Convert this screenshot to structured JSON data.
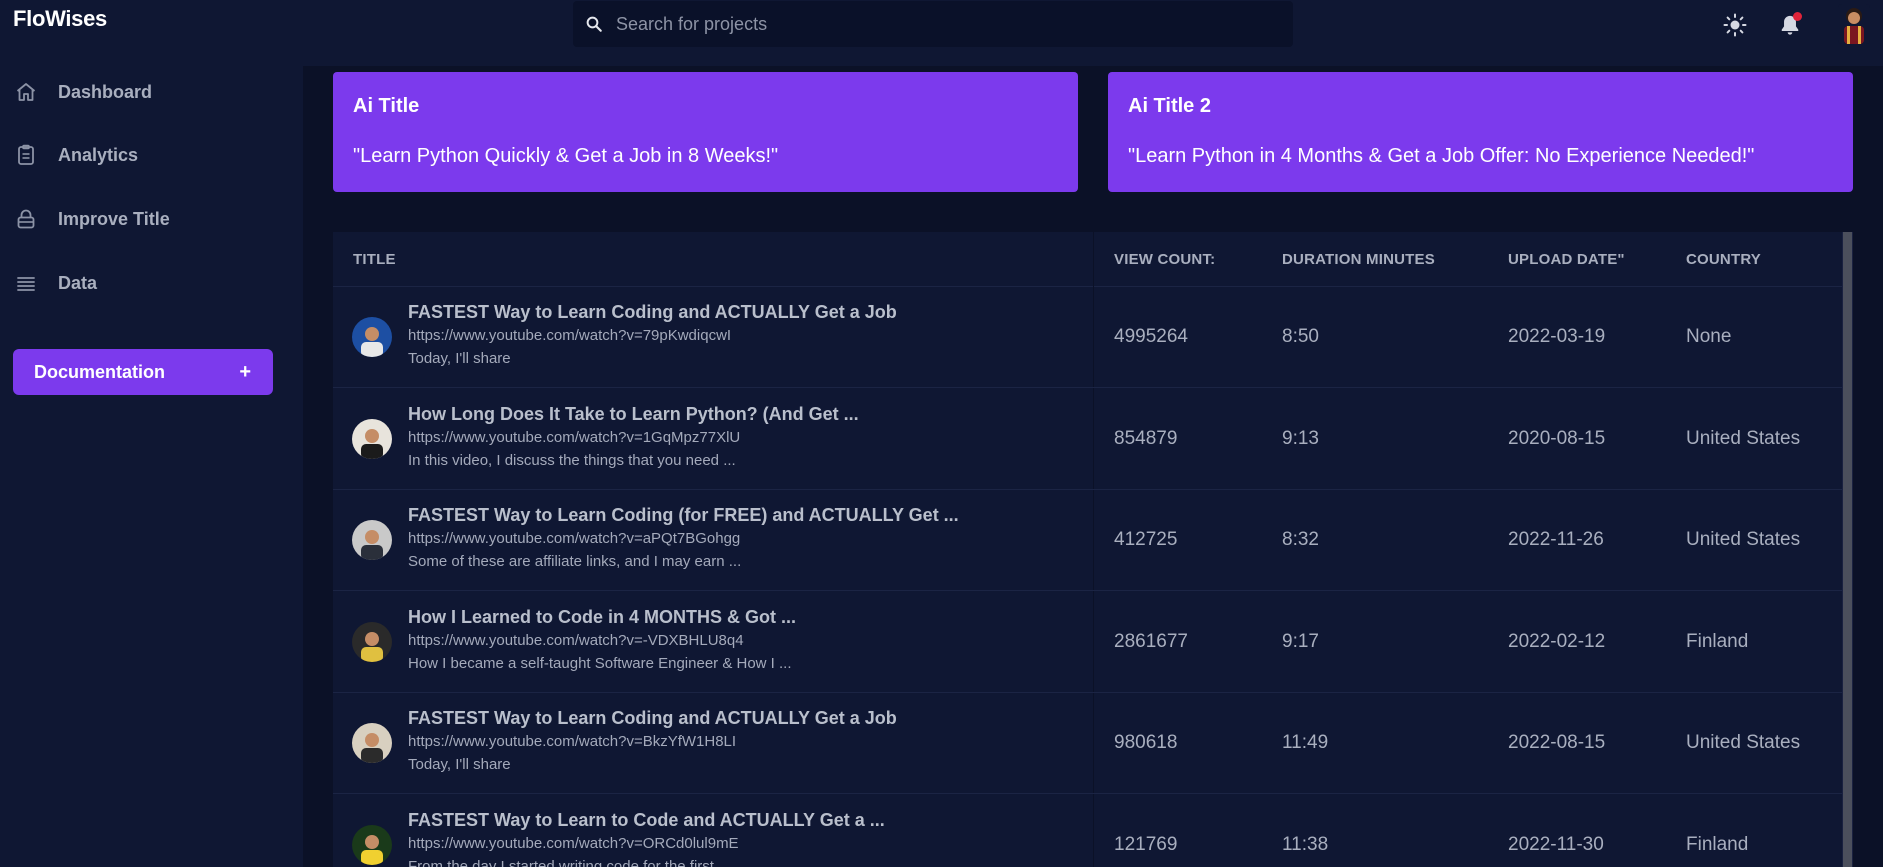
{
  "app": {
    "name": "FloWises"
  },
  "search": {
    "placeholder": "Search for projects"
  },
  "sidebar": {
    "items": [
      {
        "label": "Dashboard",
        "icon": "home-icon"
      },
      {
        "label": "Analytics",
        "icon": "clipboard-icon"
      },
      {
        "label": "Improve Title",
        "icon": "lock-icon"
      },
      {
        "label": "Data",
        "icon": "list-icon"
      }
    ],
    "documentation": {
      "label": "Documentation",
      "plus": "+"
    }
  },
  "ai_cards": [
    {
      "title": "Ai Title",
      "text": "\"Learn Python Quickly & Get a Job in 8 Weeks!\""
    },
    {
      "title": "Ai Title 2",
      "text": "\"Learn Python in 4 Months & Get a Job Offer: No Experience Needed!\""
    }
  ],
  "table": {
    "headers": [
      "TITLE",
      "VIEW COUNT:",
      "DURATION MINUTES",
      "UPLOAD DATE\"",
      "COUNTRY"
    ],
    "rows": [
      {
        "title": "FASTEST Way to Learn Coding and ACTUALLY Get a Job",
        "url": "https://www.youtube.com/watch?v=79pKwdiqcwI",
        "desc": "Today, I'll share",
        "views": "4995264",
        "duration": "8:50",
        "date": "2022-03-19",
        "country": "None"
      },
      {
        "title": "How Long Does It Take to Learn Python? (And Get ...",
        "url": "https://www.youtube.com/watch?v=1GqMpz77XlU",
        "desc": "In this video, I discuss the things that you need ...",
        "views": "854879",
        "duration": "9:13",
        "date": "2020-08-15",
        "country": "United States"
      },
      {
        "title": "FASTEST Way to Learn Coding (for FREE) and ACTUALLY Get ...",
        "url": "https://www.youtube.com/watch?v=aPQt7BGohgg",
        "desc": "Some of these are affiliate links, and I may earn ...",
        "views": "412725",
        "duration": "8:32",
        "date": "2022-11-26",
        "country": "United States"
      },
      {
        "title": "How I Learned to Code in 4 MONTHS & Got ...",
        "url": "https://www.youtube.com/watch?v=-VDXBHLU8q4",
        "desc": "How I became a self-taught Software Engineer & How I ...",
        "views": "2861677",
        "duration": "9:17",
        "date": "2022-02-12",
        "country": "Finland"
      },
      {
        "title": "FASTEST Way to Learn Coding and ACTUALLY Get a Job",
        "url": "https://www.youtube.com/watch?v=BkzYfW1H8LI",
        "desc": "Today, I'll share",
        "views": "980618",
        "duration": "11:49",
        "date": "2022-08-15",
        "country": "United States"
      },
      {
        "title": "FASTEST Way to Learn to Code and ACTUALLY Get a ...",
        "url": "https://www.youtube.com/watch?v=ORCd0lul9mE",
        "desc": "From the day I started writing code for the first ...",
        "views": "121769",
        "duration": "11:38",
        "date": "2022-11-30",
        "country": "Finland"
      }
    ]
  },
  "colors": {
    "accent": "#7c3aed",
    "background": "#0f1733",
    "panel": "#0b1127",
    "notification": "#e0243a"
  }
}
